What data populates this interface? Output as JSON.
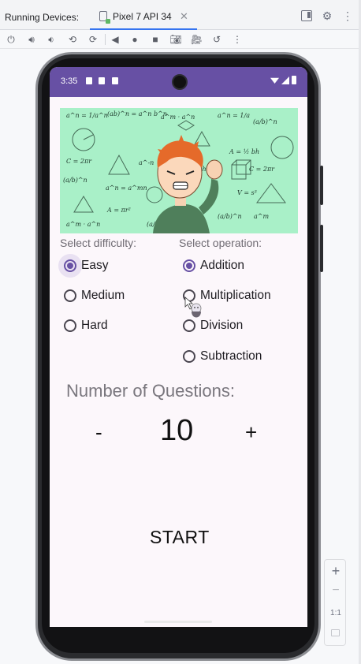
{
  "ide": {
    "tab_label": "Running Devices:",
    "device_tab": "Pixel 7 API 34",
    "close_glyph": "✕",
    "zoom": {
      "plus": "+",
      "minus": "−",
      "actual": "1:1"
    }
  },
  "phone": {
    "status": {
      "time": "3:35"
    },
    "labels": {
      "difficulty": "Select difficulty:",
      "operation": "Select operation:"
    },
    "difficulty_options": [
      "Easy",
      "Medium",
      "Hard"
    ],
    "difficulty_selected": "Easy",
    "operation_options": [
      "Addition",
      "Multiplication",
      "Division",
      "Subtraction"
    ],
    "operation_selected": "Addition",
    "questions": {
      "title": "Number of Questions:",
      "minus": "-",
      "value": "10",
      "plus": "+"
    },
    "start_label": "START"
  },
  "colors": {
    "status_bar": "#6750a4",
    "accent": "#6750a4",
    "banner_bg": "#a9f0c8",
    "screen_bg": "#fcf7fb"
  }
}
